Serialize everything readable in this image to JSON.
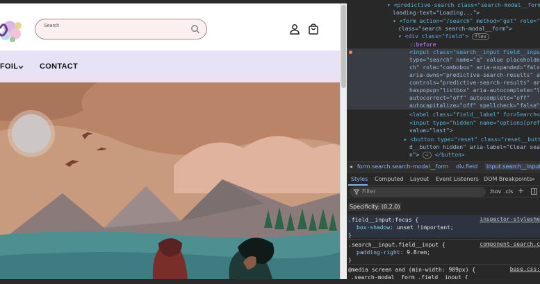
{
  "store": {
    "search_placeholder": "Search",
    "nav": [
      "FOIL",
      "CONTACT"
    ],
    "icons": [
      "logo-icon",
      "search-icon",
      "account-icon",
      "cart-icon",
      "chevron-down-icon"
    ]
  },
  "devtools": {
    "dom_lines": [
      "<predictive-search class=\"search-modal__form\" d",
      "loading-text=\"Loading...\">",
      "<form action=\"/search\" method=\"get\" role=\"sea",
      "class=\"search search-modal__form\">",
      "<div class=\"field\">",
      "flex",
      "::before",
      "<input class=\"search__input field__input\"",
      "type=\"search\" name=\"q\" value placeholder=\"",
      "ch\" role=\"combobox\" aria-expanded=\"false\"",
      "aria-owns=\"predictive-search-results\" aria",
      "controls=\"predictive-search-results\" aria-",
      "haspopup=\"listbox\" aria-autocomplete=\"list",
      "autocorrect=\"off\" autocomplete=\"off\"",
      "autocapitalize=\"off\" spellcheck=\"false\"> ==",
      "<label class=\"field__label\" for>Search</l",
      "<input type=\"hidden\" name=\"options[prefix]",
      "value=\"last\">",
      "<button type=\"reset\" class=\"reset__button",
      "d__button hidden\" aria-label=\"Clear search",
      "n\">",
      "</button>"
    ],
    "breadcrumbs": [
      "form.search.search-modal__form",
      "div.field",
      "input.search__input.field__in"
    ],
    "tabs": [
      "Styles",
      "Computed",
      "Layout",
      "Event Listeners",
      "DOM Breakpoints"
    ],
    "filter_placeholder": "Filter",
    "filter_controls": [
      ":hov",
      ".cls",
      "+"
    ],
    "specificity": "Specificity: (0,2,0)",
    "rules": [
      {
        "selector": ".field__input:focus {",
        "prop": "box-shadow",
        "value": "unset !important;",
        "source": "inspector-styleshe"
      },
      {
        "selector": ".search__input.field__input {",
        "prop": "padding-right",
        "value": "9.8rem;",
        "source": "component-search.c"
      },
      {
        "selector": "@media screen and (min-width: 989px) {",
        "selector2": ".search-modal__form .field__input {",
        "source": "base.css:"
      }
    ]
  }
}
